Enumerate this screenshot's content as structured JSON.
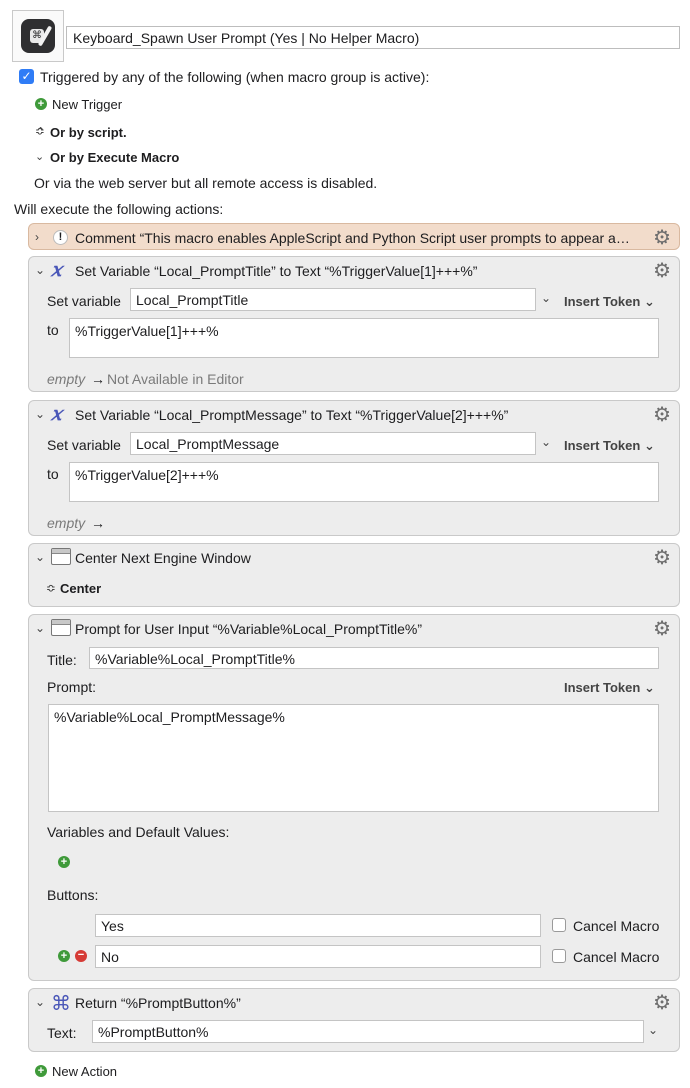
{
  "macro": {
    "name": "Keyboard_Spawn User Prompt (Yes | No Helper Macro)",
    "trigger_checkbox_label": "Triggered by any of the following (when macro group is active):",
    "new_trigger": "New Trigger",
    "or_by_script": "Or by script.",
    "or_by_execute": "Or by Execute Macro",
    "web_server_note": "Or via the web server but all remote access is disabled.",
    "will_execute": "Will execute the following actions:",
    "new_action": "New Action"
  },
  "actions": {
    "comment": {
      "title": "Comment “This macro enables AppleScript and Python Script user prompts to appear a…"
    },
    "setvar1": {
      "title": "Set Variable “Local_PromptTitle” to Text “%TriggerValue[1]+++%”",
      "set_label": "Set variable",
      "variable": "Local_PromptTitle",
      "insert_token": "Insert Token",
      "to_label": "to",
      "value": "%TriggerValue[1]+++%",
      "preview_empty": "empty",
      "preview_arrow": "→",
      "preview_result": "Not Available in Editor"
    },
    "setvar2": {
      "title": "Set Variable “Local_PromptMessage” to Text “%TriggerValue[2]+++%”",
      "set_label": "Set variable",
      "variable": "Local_PromptMessage",
      "insert_token": "Insert Token",
      "to_label": "to",
      "value": "%TriggerValue[2]+++%",
      "preview_empty": "empty",
      "preview_arrow": "→"
    },
    "center": {
      "title": "Center Next Engine Window",
      "option": "Center"
    },
    "prompt": {
      "title": "Prompt for User Input “%Variable%Local_PromptTitle%”",
      "title_label": "Title:",
      "title_value": "%Variable%Local_PromptTitle%",
      "prompt_label": "Prompt:",
      "insert_token": "Insert Token",
      "prompt_value": "%Variable%Local_PromptMessage%",
      "vars_label": "Variables and Default Values:",
      "buttons_label": "Buttons:",
      "buttons": [
        {
          "name": "Yes",
          "cancel_label": "Cancel Macro"
        },
        {
          "name": "No",
          "cancel_label": "Cancel Macro"
        }
      ]
    },
    "return": {
      "title": "Return “%PromptButton%”",
      "text_label": "Text:",
      "text_value": "%PromptButton%"
    }
  },
  "icons": {
    "gear": "gear-icon",
    "variable": "variable-x-icon",
    "window": "window-icon",
    "command": "command-icon",
    "comment": "exclamation-icon"
  },
  "colors": {
    "accent": "#2f7cf6",
    "comment_bg": "#f2dccb",
    "action_bg": "#ededed",
    "variable_icon": "#4a57b8",
    "add_green": "#3f9a3a",
    "remove_red": "#d63b36"
  }
}
